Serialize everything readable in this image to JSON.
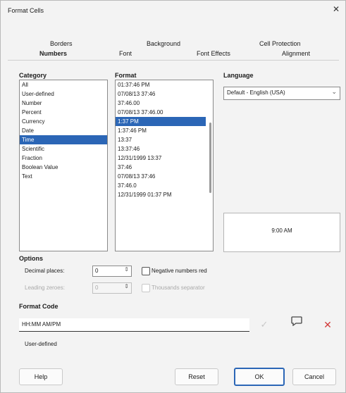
{
  "window": {
    "title": "Format Cells",
    "close_icon": "close-icon"
  },
  "tabs_row1": [
    "Borders",
    "Background",
    "Cell Protection"
  ],
  "tabs_row2": [
    "Numbers",
    "Font",
    "Font Effects",
    "Alignment"
  ],
  "active_tab": "Numbers",
  "category": {
    "label": "Category",
    "items": [
      "All",
      "User-defined",
      "Number",
      "Percent",
      "Currency",
      "Date",
      "Time",
      "Scientific",
      "Fraction",
      "Boolean Value",
      "Text"
    ],
    "selected": "Time"
  },
  "format": {
    "label": "Format",
    "items": [
      "01:37:46 PM",
      "07/08/13 37:46",
      "37:46.00",
      "07/08/13 37:46.00",
      "1:37 PM",
      "1:37:46 PM",
      "13:37",
      "13:37:46",
      "12/31/1999 13:37",
      "37:46",
      "07/08/13 37:46",
      "37:46.0",
      "12/31/1999 01:37 PM"
    ],
    "selected": "1:37 PM"
  },
  "language": {
    "label": "Language",
    "value": "Default - English (USA)"
  },
  "preview": {
    "text": "9:00 AM"
  },
  "options": {
    "label": "Options",
    "decimal_places_label": "Decimal places:",
    "decimal_places_value": "0",
    "leading_zeroes_label": "Leading zeroes:",
    "leading_zeroes_value": "0",
    "negative_red_label": "Negative numbers red",
    "thousands_sep_label": "Thousands separator"
  },
  "format_code": {
    "label": "Format Code",
    "value": "HH:MM AM/PM",
    "description": "User-defined"
  },
  "buttons": {
    "help": "Help",
    "reset": "Reset",
    "ok": "OK",
    "cancel": "Cancel"
  }
}
